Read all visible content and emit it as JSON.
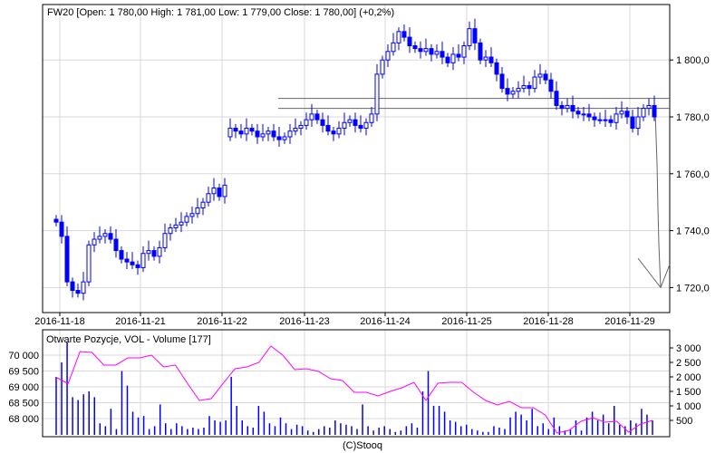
{
  "header": {
    "title": "FW20 [Open: 1 780,00  High: 1 781,00  Low: 1 779,00  Close: 1 780,00] (+0,2%)"
  },
  "footer": {
    "credit": "(C)Stooq"
  },
  "colors": {
    "candle": "#0000ff",
    "oi_line": "#ff00ff",
    "volume": "#0000ff",
    "overlay": "#666666",
    "grid": "#d8d8d8"
  },
  "chart_data": [
    {
      "type": "candlestick",
      "title": "FW20 [Open: 1 780,00  High: 1 781,00  Low: 1 779,00  Close: 1 780,00] (+0,2%)",
      "x_tick_labels": [
        "2016-11-18",
        "2016-11-21",
        "2016-11-22",
        "2016-11-23",
        "2016-11-24",
        "2016-11-25",
        "2016-11-28",
        "2016-11-29"
      ],
      "y_tick_values": [
        1720,
        1740,
        1760,
        1780,
        1800
      ],
      "y_tick_labels": [
        "1 720,0",
        "1 740,0",
        "1 760,0",
        "1 780,0",
        "1 800,0"
      ],
      "ylim": [
        1710,
        1817
      ],
      "grid": true,
      "closes": [
        1743,
        1738,
        1722,
        1719,
        1718,
        1722,
        1735,
        1737,
        1738,
        1739,
        1737,
        1733,
        1730,
        1729,
        1728,
        1727,
        1732,
        1733,
        1731,
        1734,
        1739,
        1741,
        1742,
        1743,
        1745,
        1746,
        1748,
        1750,
        1753,
        1755,
        1752,
        1756,
        1776,
        1775,
        1774,
        1776,
        1775,
        1773,
        1774,
        1775,
        1773,
        1772,
        1773,
        1775,
        1776,
        1777,
        1779,
        1781,
        1779,
        1777,
        1775,
        1774,
        1776,
        1778,
        1779,
        1777,
        1776,
        1778,
        1781,
        1795,
        1800,
        1803,
        1806,
        1810,
        1808,
        1805,
        1804,
        1803,
        1804,
        1802,
        1803,
        1801,
        1799,
        1802,
        1801,
        1805,
        1811,
        1806,
        1800,
        1801,
        1799,
        1795,
        1790,
        1788,
        1789,
        1790,
        1791,
        1790,
        1794,
        1795,
        1793,
        1789,
        1784,
        1783,
        1784,
        1782,
        1781,
        1781,
        1780,
        1779,
        1779,
        1779,
        1778,
        1781,
        1782,
        1780,
        1776,
        1780,
        1783,
        1784,
        1780
      ],
      "horizontal_levels": [
        1786.5,
        1783
      ],
      "projection_target": 1720
    },
    {
      "type": "bar+line",
      "title": "Otwarte Pozycje, VOL - Volume [177]",
      "left_axis_label_values": [
        68000,
        68500,
        69000,
        69500,
        70000
      ],
      "left_axis_labels": [
        "68 000",
        "68 500",
        "69 000",
        "69 500",
        "70 000"
      ],
      "right_axis_label_values": [
        500,
        1000,
        1500,
        2000,
        2500,
        3000
      ],
      "right_axis_labels": [
        "500",
        "1 000",
        "1 500",
        "2 000",
        "2 500",
        "3 000"
      ],
      "open_interest": [
        69300,
        69100,
        70114,
        70086,
        69686,
        69686,
        69914,
        69914,
        70000,
        69629,
        69686,
        69114,
        68571,
        68629,
        69114,
        69571,
        69629,
        69771,
        70286,
        70000,
        69543,
        69571,
        69486,
        69257,
        69200,
        68829,
        68829,
        68714,
        68857,
        68971,
        69143,
        68571,
        69114,
        69143,
        69143,
        68829,
        68571,
        68429,
        68543,
        68343,
        68343,
        68114,
        67543,
        67629,
        67914,
        68029,
        67886,
        67914,
        67571,
        67829,
        67943
      ],
      "volume": [
        2000,
        2500,
        3200,
        1300,
        1200,
        1400,
        1500,
        1300,
        400,
        300,
        900,
        200,
        2200,
        1700,
        800,
        600,
        650,
        200,
        300,
        1050,
        400,
        200,
        400,
        300,
        200,
        250,
        200,
        250,
        650,
        500,
        450,
        500,
        2000,
        1000,
        500,
        300,
        250,
        1000,
        800,
        400,
        300,
        600,
        400,
        200,
        350,
        300,
        150,
        100,
        200,
        300,
        250,
        500,
        400,
        350,
        300,
        200,
        1050,
        300,
        150,
        250,
        300,
        200,
        100,
        150,
        300,
        400,
        250,
        1500,
        2200,
        1000,
        1000,
        800,
        500,
        450,
        300,
        350,
        200,
        150,
        100,
        100,
        300,
        250,
        200,
        600,
        800,
        700,
        500,
        900,
        300,
        400,
        200,
        600,
        300,
        150,
        200,
        500,
        150,
        600,
        800,
        500,
        700,
        400,
        1000,
        350,
        300,
        500,
        400,
        900,
        700,
        500
      ]
    }
  ]
}
